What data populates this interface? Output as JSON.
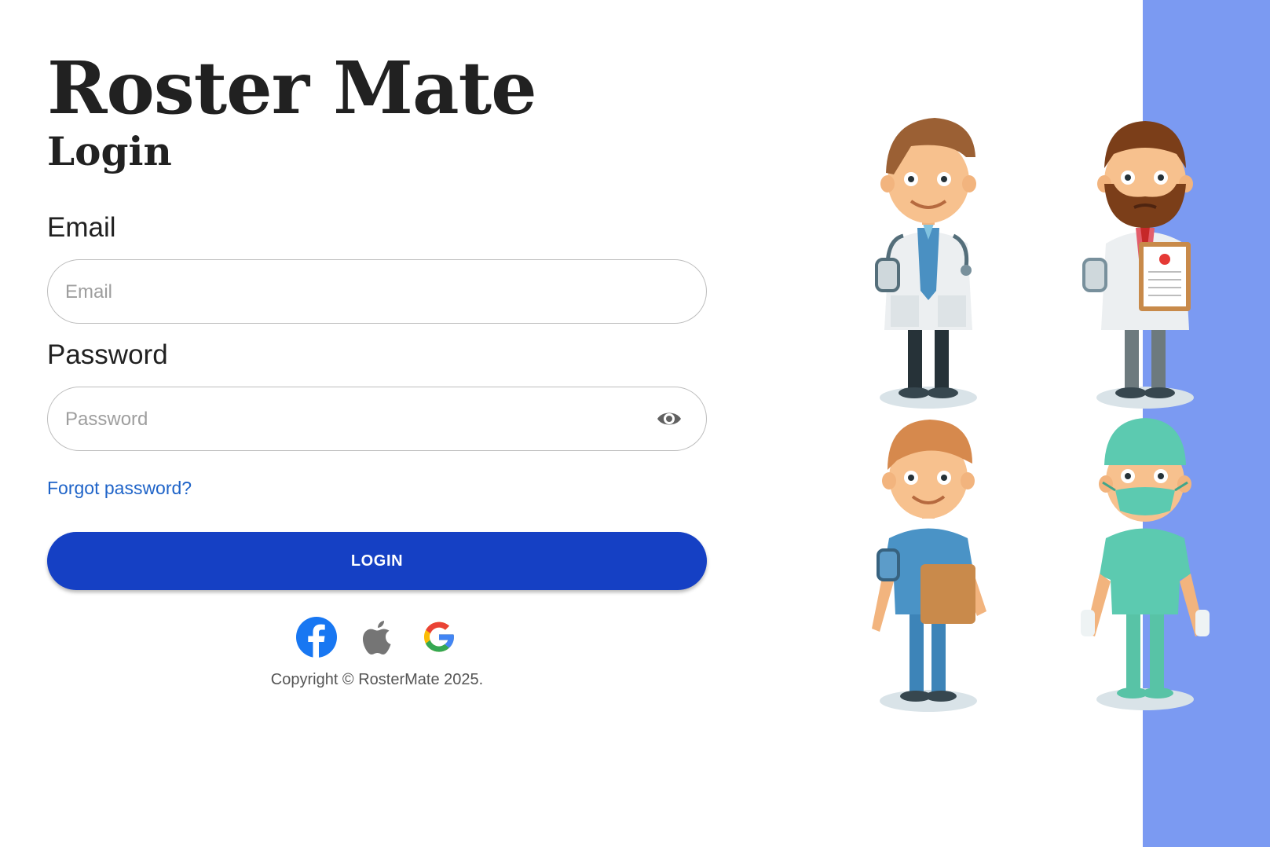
{
  "app": {
    "title": "Roster Mate"
  },
  "login": {
    "heading": "Login",
    "email_label": "Email",
    "email_placeholder": "Email",
    "email_value": "",
    "password_label": "Password",
    "password_placeholder": "Password",
    "password_value": "",
    "forgot_password": "Forgot password?",
    "login_button": "LOGIN"
  },
  "social": [
    {
      "icon": "facebook-icon",
      "color": "#1877f2"
    },
    {
      "icon": "apple-icon",
      "color": "#757575"
    },
    {
      "icon": "google-icon",
      "color": "#4285f4"
    }
  ],
  "footer": {
    "copyright": "Copyright © RosterMate 2025."
  },
  "theme": {
    "accent": "#1540c4",
    "link": "#1e63c8",
    "band": "#7b9af2"
  },
  "illustration": {
    "icon": "medical-staff-illustration",
    "figures": [
      "doctor-icon",
      "bearded-doctor-icon",
      "nurse-icon",
      "surgeon-icon"
    ]
  }
}
